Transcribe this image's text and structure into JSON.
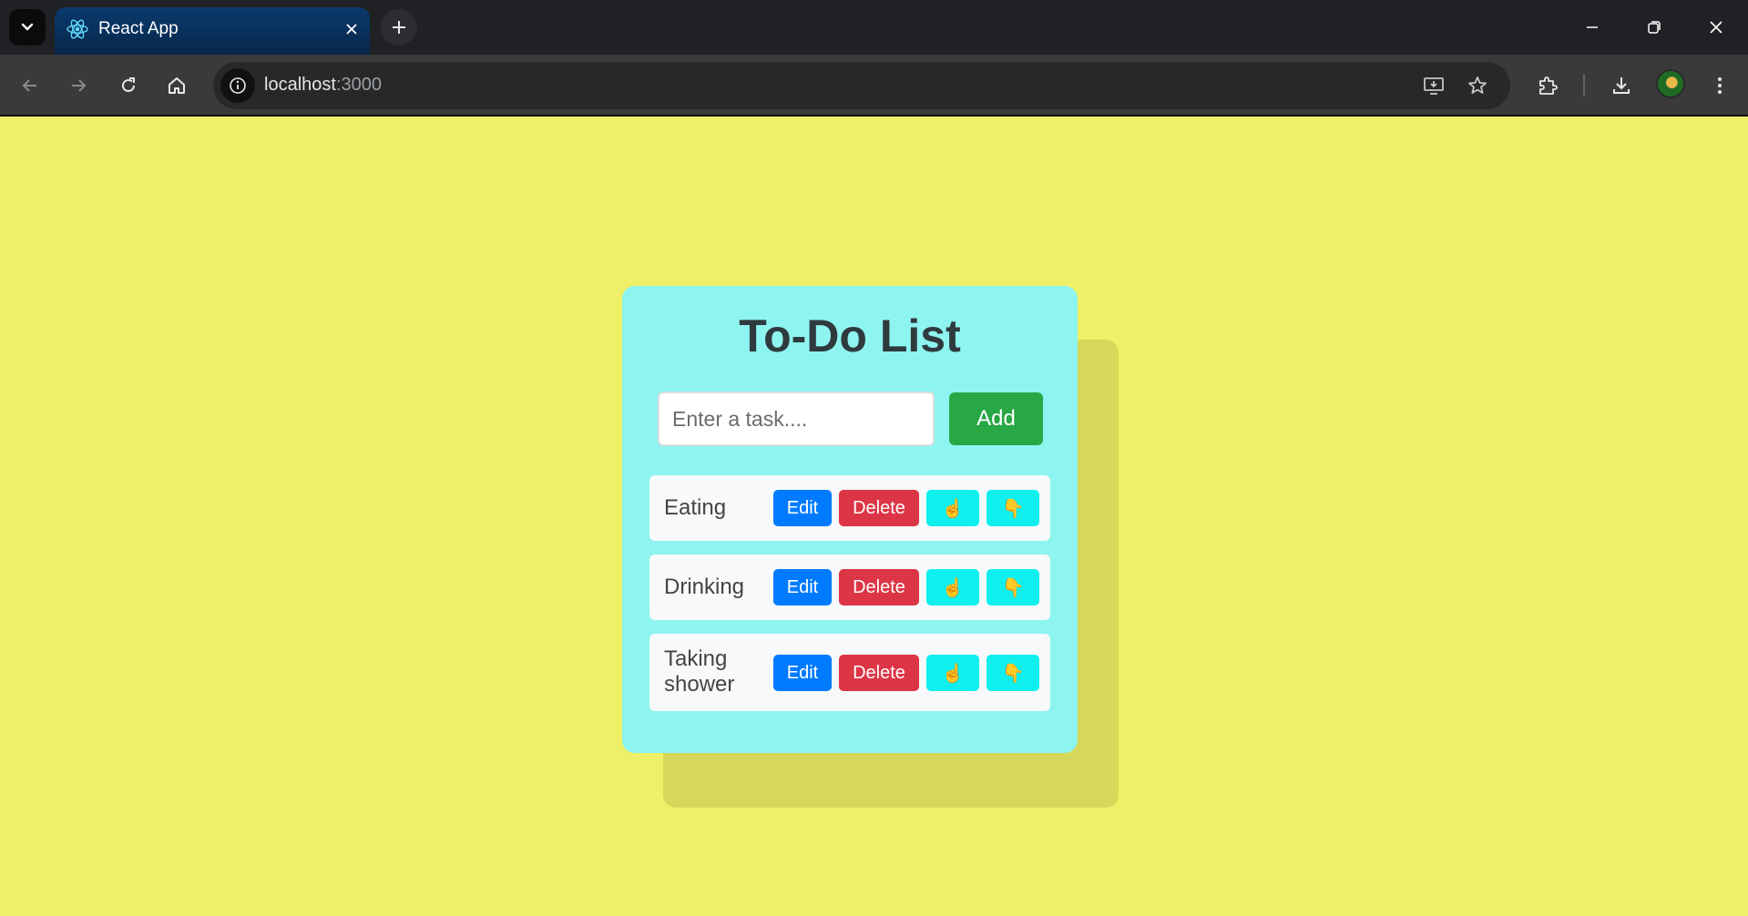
{
  "browser": {
    "tab_title": "React App",
    "url_host": "localhost",
    "url_port": ":3000"
  },
  "app": {
    "title": "To-Do List",
    "input_placeholder": "Enter a task....",
    "input_value": "",
    "add_label": "Add",
    "edit_label": "Edit",
    "delete_label": "Delete",
    "move_up_glyph": "☝",
    "move_down_glyph": "👇",
    "tasks": [
      "Eating",
      "Drinking",
      "Taking shower"
    ]
  },
  "colors": {
    "page_background": "#eef067",
    "card_background": "#8ef4ef",
    "add_button": "#28a745",
    "edit_button": "#007bff",
    "delete_button": "#dc3545",
    "move_button": "#0ff0ee"
  },
  "icons": [
    "tab-search-icon",
    "react-favicon-icon",
    "close-icon",
    "plus-icon",
    "minimize-icon",
    "restore-icon",
    "window-close-icon",
    "back-arrow-icon",
    "forward-arrow-icon",
    "reload-icon",
    "home-icon",
    "site-info-icon",
    "install-app-icon",
    "bookmark-star-icon",
    "extensions-icon",
    "download-icon",
    "kebab-menu-icon"
  ]
}
